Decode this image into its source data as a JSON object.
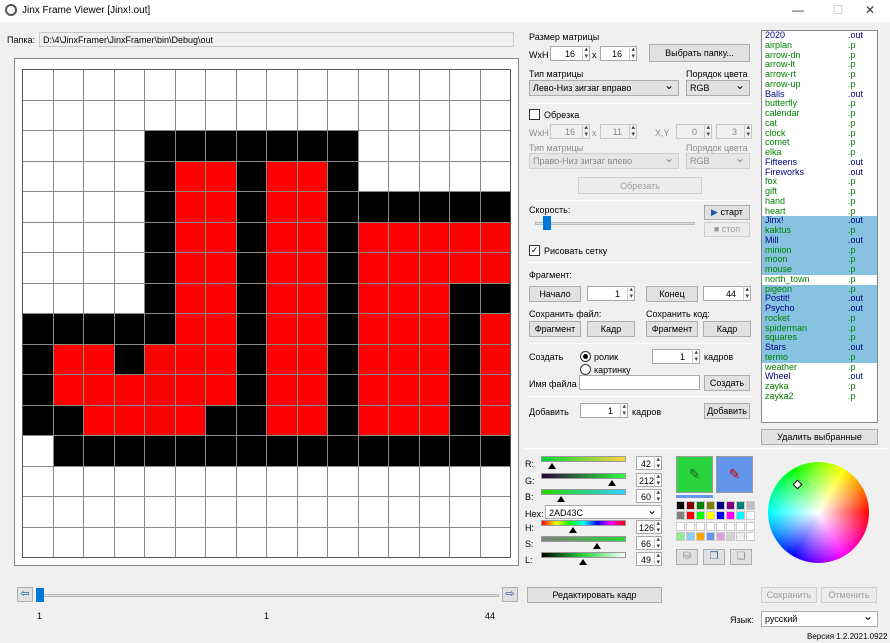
{
  "window": {
    "title": "Jinx Frame Viewer [Jinx!.out]",
    "minimize": "—",
    "maximize": "☐",
    "close": "✕"
  },
  "folder": {
    "label": "Папка:",
    "value": "D:\\4\\JinxFramer\\JinxFramer\\bin\\Debug\\out"
  },
  "matrix_size": {
    "title": "Размер матрицы",
    "wxh_label": "WxH",
    "width": "16",
    "x": "x",
    "height": "16",
    "select_folder": "Выбрать папку..."
  },
  "matrix_type": {
    "label": "Тип матрицы",
    "value": "Лево-Низ зигзаг вправо",
    "color_order_label": "Порядок цвета",
    "color_order": "RGB"
  },
  "crop": {
    "label": "Обрезка",
    "wxh_label": "WxH",
    "w": "16",
    "x": "x",
    "h": "11",
    "xy_label": "X,Y",
    "cx": "0",
    "cy": "3",
    "type_label": "Тип матрицы",
    "type_value": "Право-Низ зигзаг влево",
    "order_label": "Порядок цвета",
    "order_value": "RGB",
    "crop_button": "Обрезать"
  },
  "speed": {
    "label": "Скорость:",
    "start": "старт",
    "stop": "стоп",
    "draw_grid": "Рисовать сетку"
  },
  "fragment": {
    "label": "Фрагмент:",
    "start_button": "Начало",
    "start_value": "1",
    "end_button": "Конец",
    "end_value": "44",
    "save_file_label": "Сохранить файл:",
    "save_code_label": "Сохранить код:",
    "frag1": "Фрагмент",
    "frame1": "Кадр",
    "frag2": "Фрагмент",
    "frame2": "Кадр"
  },
  "create": {
    "label": "Создать",
    "radio_movie": "ролик",
    "radio_picture": "картинку",
    "frames_value": "1",
    "frames_label": "кадров",
    "filename_label": "Имя файла",
    "create_button": "Создать"
  },
  "add": {
    "label": "Добавить",
    "value": "1",
    "frames_label": "кадров",
    "button": "Добавить"
  },
  "color": {
    "r_label": "R:",
    "r": "42",
    "g_label": "G:",
    "g": "212",
    "b_label": "B:",
    "b": "60",
    "hex_label": "Hex:",
    "hex": "2AD43C",
    "h_label": "H:",
    "h": "126",
    "s_label": "S:",
    "s": "66",
    "l_label": "L:",
    "l": "49"
  },
  "files": [
    {
      "name": "2020",
      "ext": ".out",
      "color": "#000080"
    },
    {
      "name": "airplan",
      "ext": ".p",
      "color": "#008000"
    },
    {
      "name": "arrow-dn",
      "ext": ".p",
      "color": "#008000"
    },
    {
      "name": "arrow-lt",
      "ext": ".p",
      "color": "#008000"
    },
    {
      "name": "arrow-rt",
      "ext": ".p",
      "color": "#008000"
    },
    {
      "name": "arrow-up",
      "ext": ".p",
      "color": "#008000"
    },
    {
      "name": "Balls",
      "ext": ".out",
      "color": "#000080"
    },
    {
      "name": "butterfly",
      "ext": ".p",
      "color": "#008000"
    },
    {
      "name": "calendar",
      "ext": ".p",
      "color": "#008000"
    },
    {
      "name": "cat",
      "ext": ".p",
      "color": "#008000"
    },
    {
      "name": "clock",
      "ext": ".p",
      "color": "#008000"
    },
    {
      "name": "comet",
      "ext": ".p",
      "color": "#008000"
    },
    {
      "name": "elka",
      "ext": ".p",
      "color": "#008000"
    },
    {
      "name": "Fifteens",
      "ext": ".out",
      "color": "#000080"
    },
    {
      "name": "Fireworks",
      "ext": ".out",
      "color": "#000080"
    },
    {
      "name": "fox",
      "ext": ".p",
      "color": "#008000"
    },
    {
      "name": "gift",
      "ext": ".p",
      "color": "#008000"
    },
    {
      "name": "hand",
      "ext": ".p",
      "color": "#008000"
    },
    {
      "name": "heart",
      "ext": ".p",
      "color": "#008000"
    },
    {
      "name": "Jinx!",
      "ext": ".out",
      "color": "#000080",
      "selected": true
    },
    {
      "name": "kaktus",
      "ext": ".p",
      "color": "#008000",
      "selected": true
    },
    {
      "name": "Mill",
      "ext": ".out",
      "color": "#000080",
      "selected": true
    },
    {
      "name": "minion",
      "ext": ".p",
      "color": "#008000",
      "selected": true
    },
    {
      "name": "moon",
      "ext": ".p",
      "color": "#008000",
      "selected": true
    },
    {
      "name": "mouse",
      "ext": ".p",
      "color": "#008000",
      "selected": true
    },
    {
      "name": "north_town",
      "ext": ".p",
      "color": "#008000"
    },
    {
      "name": "pigeon",
      "ext": ".p",
      "color": "#008000",
      "selected": true
    },
    {
      "name": "Postit!",
      "ext": ".out",
      "color": "#000080",
      "selected": true
    },
    {
      "name": "Psycho",
      "ext": ".out",
      "color": "#000080",
      "selected": true
    },
    {
      "name": "rocket",
      "ext": ".p",
      "color": "#008000",
      "selected": true
    },
    {
      "name": "spiderman",
      "ext": ".p",
      "color": "#008000",
      "selected": true
    },
    {
      "name": "squares",
      "ext": ".p",
      "color": "#008000",
      "selected": true
    },
    {
      "name": "Stars",
      "ext": ".out",
      "color": "#000080",
      "selected": true
    },
    {
      "name": "termo",
      "ext": ".p",
      "color": "#008000",
      "selected": true
    },
    {
      "name": "weather",
      "ext": ".p",
      "color": "#008000"
    },
    {
      "name": "Wheel",
      "ext": ".out",
      "color": "#000080"
    },
    {
      "name": "zayka",
      "ext": ".p",
      "color": "#008000"
    },
    {
      "name": "zayka2",
      "ext": ".p",
      "color": "#008000"
    }
  ],
  "delete_selected": "Удалить выбранные",
  "save": "Сохранить",
  "cancel": "Отменить",
  "language": {
    "label": "Язык:",
    "value": "русский"
  },
  "version": "Версия 1.2.2021.0922",
  "timeline": {
    "min": "1",
    "current": "1",
    "max": "44",
    "position": 0
  },
  "edit_frame": "Редактировать кадр",
  "frame_rows": [
    "WWWWWWWWWWWWWWWW",
    "WWWWWWWWWWWWWWWW",
    "WWWWKKKKKKKWWWWW",
    "WWWWKRRKRRKWWWWW",
    "WWWWKRRKRRKKKKKK",
    "WWWWKRRKRRKRRRRR",
    "WWWWKRRKRRKRRRRR",
    "WWWWKRRKRRKRRRKK",
    "KKKKKRRKRRKRRRKR",
    "KRRKRRRKRRKRRRKR",
    "KRRRRRRKRRKRRRKR",
    "KKRRRRKKRRKRRRKR",
    "WKKKKKKKKKKKKKKK",
    "WWWWWWWWWWWWWWWW",
    "WWWWWWWWWWWWWWWW",
    "WWWWWWWWWWWWWWWW"
  ],
  "palette": [
    "#000000",
    "#800000",
    "#008000",
    "#808000",
    "#000080",
    "#800080",
    "#008080",
    "#c0c0c0",
    "#808080",
    "#ff0000",
    "#00ff00",
    "#ffff00",
    "#0000ff",
    "#ff00ff",
    "#00ffff",
    "#ffffff",
    "#ffffff",
    "#ffffff",
    "#ffffff",
    "#ffffff",
    "#ffffff",
    "#ffffff",
    "#ffffff",
    "#ffffff",
    "#90ee90",
    "#87cefa",
    "#ffa500",
    "#6495ed",
    "#dda0dd",
    "#d3d3d3",
    "#f0f0f0",
    "#ffffff"
  ],
  "colors": {
    "current": "#2ad43c",
    "secondary": "#6495ed",
    "selection": "#87c3e0",
    "red": "#ff0000",
    "black": "#000000",
    "white": "#ffffff"
  }
}
